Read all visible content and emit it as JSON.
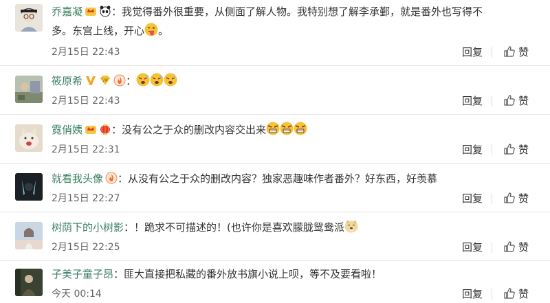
{
  "comments": [
    {
      "username": "乔嘉凝",
      "badges": [
        "crown-badge-icon",
        "panda-badge-icon"
      ],
      "text_line1": "我觉得番外很重要，从侧面了解人物。我特别想了解李承鄞，就是番外也写得不",
      "text_line2": "多。东宫上线，开心",
      "emojis": [
        "tongue-out-emoji-icon"
      ],
      "time": "2月15日 22:43",
      "reply_label": "回复",
      "like_label": "赞"
    },
    {
      "username": "筱原希",
      "badges": [
        "v-verified-icon",
        "vip-badge-icon",
        "fire-badge-icon"
      ],
      "text_line1": "",
      "emojis": [
        "sweat-emoji-icon",
        "sweat-emoji-icon",
        "sweat-emoji-icon"
      ],
      "time": "2月15日 22:43",
      "reply_label": "回复",
      "like_label": "赞"
    },
    {
      "username": "霓俏姨",
      "badges": [
        "crown-badge-icon",
        "lantern-badge-icon"
      ],
      "text_line1": "没有公之于众的删改内容交出来",
      "emojis": [
        "angry-emoji-icon",
        "angry-emoji-icon",
        "angry-emoji-icon"
      ],
      "time": "2月15日 22:31",
      "reply_label": "回复",
      "like_label": "赞"
    },
    {
      "username": "就看我头像",
      "badges": [
        "fire-badge-icon"
      ],
      "text_line1": "从没有公之于众的删改内容？独家恶趣味作者番外？好东西，好羡慕",
      "time": "2月15日 22:27",
      "reply_label": "回复",
      "like_label": "赞"
    },
    {
      "username": "树荫下的小树影",
      "badges": [],
      "text_line1": "！跪求不可描述的！(也许你是喜欢朦胧鸳鸯派",
      "emojis": [
        "doge-emoji-icon"
      ],
      "time": "2月15日 22:25",
      "reply_label": "回复",
      "like_label": "赞"
    },
    {
      "username": "子美子童子昂",
      "badges": [],
      "text_line1": "匪大直接把私藏的番外放书旗小说上呗，等不及要看啦！",
      "time": "今天 00:14",
      "reply_label": "回复",
      "like_label": "赞"
    }
  ],
  "colors": {
    "username": "#3b7f62",
    "text": "#333333",
    "meta": "#666666",
    "divider": "#e5e5e5"
  }
}
